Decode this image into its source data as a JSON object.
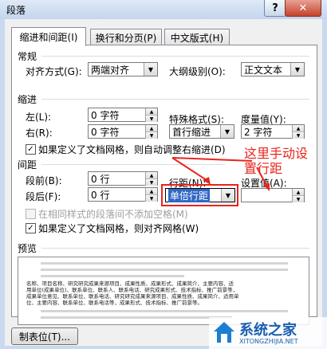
{
  "window": {
    "title": "段落",
    "help_label": "?",
    "close_label": "✕"
  },
  "tabs": [
    {
      "label": "缩进和间距(I)",
      "active": true
    },
    {
      "label": "换行和分页(P)",
      "active": false
    },
    {
      "label": "中文版式(H)",
      "active": false
    }
  ],
  "general": {
    "section": "常规",
    "alignment_label": "对齐方式(G):",
    "alignment_value": "两端对齐",
    "outline_label": "大纲级别(O):",
    "outline_value": "正文文本"
  },
  "indent": {
    "section": "缩进",
    "left_label": "左(L):",
    "left_value": "0 字符",
    "right_label": "右(R):",
    "right_value": "0 字符",
    "special_label": "特殊格式(S):",
    "special_value": "首行缩进",
    "amount_label": "度量值(Y):",
    "amount_value": "2 字符",
    "grid_check_label": "如果定义了文档网格，则自动调整右缩进(D)",
    "grid_check_checked": true
  },
  "spacing": {
    "section": "间距",
    "before_label": "段前(B):",
    "before_value": "0 行",
    "after_label": "段后(F):",
    "after_value": "0 行",
    "line_label": "行距(N):",
    "line_value": "单倍行距",
    "at_label": "设置值(A):",
    "at_value": "",
    "no_space_label": "在相同样式的段落间不添加空格(M)",
    "no_space_checked": false,
    "snap_label": "如果定义了文档网格，则对齐网格(W)",
    "snap_checked": true
  },
  "preview": {
    "section": "预览",
    "text_lines": [
      "名称、项目名称、研究研究成果来源项目、成果性质、成果形式、成果简介、主要内容、适",
      "用单位(成果单位)、联系单位、联系人、联系电话、研究成果形式、技术指标、推广前景等，",
      "成果单位意见、联系单位、联系电话、研究研究成果来源项目、成果性质、成果简介、适用单",
      "位、主要内容、联系单位、联系电话等，成果形式、技术指标、推广前景等。"
    ]
  },
  "footer": {
    "tabs_button": "制表位(T)..."
  },
  "annotation": {
    "text": "这里手动设置行距"
  },
  "watermark": {
    "name": "系统之家",
    "url": "XITONGZHIJIA.NET"
  }
}
